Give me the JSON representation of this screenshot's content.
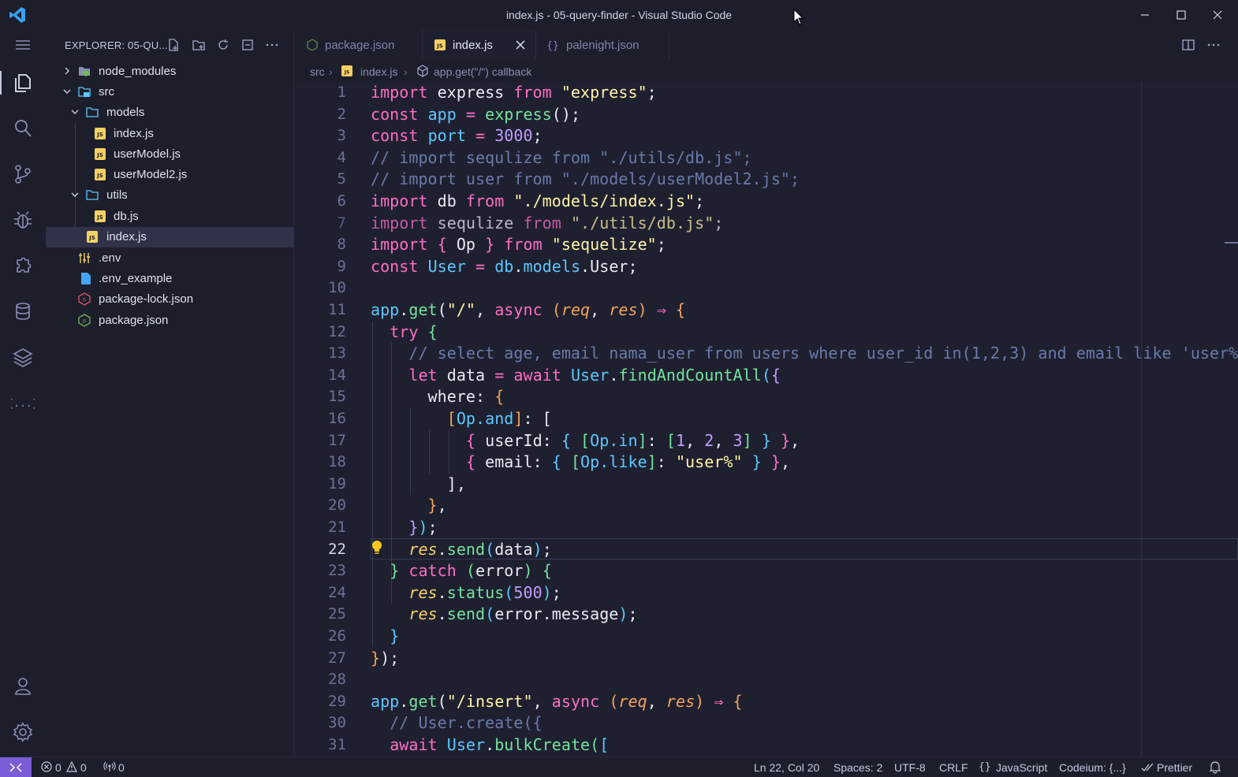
{
  "window": {
    "title": "index.js - 05-query-finder - Visual Studio Code"
  },
  "sidebar": {
    "header": "EXPLORER: 05-QU...",
    "tree": [
      {
        "label": "node_modules",
        "depth": 0,
        "kind": "folder",
        "expanded": false
      },
      {
        "label": "src",
        "depth": 0,
        "kind": "folder",
        "expanded": true
      },
      {
        "label": "models",
        "depth": 1,
        "kind": "folder",
        "expanded": true
      },
      {
        "label": "index.js",
        "depth": 2,
        "kind": "js"
      },
      {
        "label": "userModel.js",
        "depth": 2,
        "kind": "js"
      },
      {
        "label": "userModel2.js",
        "depth": 2,
        "kind": "js"
      },
      {
        "label": "utils",
        "depth": 1,
        "kind": "folder",
        "expanded": true
      },
      {
        "label": "db.js",
        "depth": 2,
        "kind": "js"
      },
      {
        "label": "index.js",
        "depth": 1,
        "kind": "js",
        "selected": true
      },
      {
        "label": ".env",
        "depth": 0,
        "kind": "env"
      },
      {
        "label": ".env_example",
        "depth": 0,
        "kind": "file"
      },
      {
        "label": "package-lock.json",
        "depth": 0,
        "kind": "npm-lock"
      },
      {
        "label": "package.json",
        "depth": 0,
        "kind": "npm"
      }
    ]
  },
  "tabs": [
    {
      "label": "package.json",
      "icon": "nodejs-icon",
      "active": false
    },
    {
      "label": "index.js",
      "icon": "js-file-icon",
      "active": true
    },
    {
      "label": "palenight.json",
      "icon": "json-braces-icon",
      "active": false
    }
  ],
  "breadcrumb": {
    "folder": "src",
    "file": "index.js",
    "symbol": "app.get(\"/\") callback"
  },
  "editor": {
    "current_line": 22,
    "lines": [
      "1",
      "2",
      "3",
      "4",
      "5",
      "6",
      "7",
      "8",
      "9",
      "10",
      "11",
      "12",
      "13",
      "14",
      "15",
      "16",
      "17",
      "18",
      "19",
      "20",
      "21",
      "22",
      "23",
      "24",
      "25",
      "26",
      "27",
      "28",
      "29",
      "30",
      "31"
    ]
  },
  "status": {
    "errors": "0",
    "warnings": "0",
    "ports": "0",
    "position": "Ln 22, Col 20",
    "spaces": "Spaces: 2",
    "encoding": "UTF-8",
    "eol": "CRLF",
    "language": "JavaScript",
    "codeium": "Codeium: {...}",
    "prettier": "Prettier"
  },
  "colors": {
    "keyword": "#ff6ec4",
    "string": "#fff3a6",
    "function": "#74e39c",
    "class": "#5cc8ff",
    "number": "#c29dff",
    "comment": "#6a7aa8",
    "remote_badge": "#7a5cd6"
  }
}
